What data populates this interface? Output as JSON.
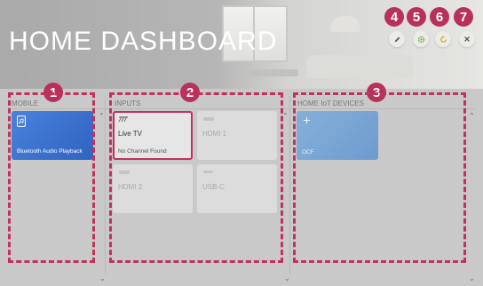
{
  "header": {
    "title": "HOME DASHBOARD",
    "buttons": [
      {
        "name": "edit",
        "icon": "pencil-icon"
      },
      {
        "name": "settings",
        "icon": "gear-icon"
      },
      {
        "name": "refresh",
        "icon": "refresh-icon"
      },
      {
        "name": "close",
        "icon": "close-icon"
      }
    ]
  },
  "callouts": [
    "1",
    "2",
    "3",
    "4",
    "5",
    "6",
    "7"
  ],
  "mobile": {
    "title": "MOBILE",
    "items": [
      {
        "label": "Bluetooth Audio Playback",
        "icon": "phone-music-icon"
      }
    ]
  },
  "inputs": {
    "title": "INPUTS",
    "items": [
      {
        "label": "Live TV",
        "status": "No Channel Found",
        "icon": "antenna-icon",
        "selected": true
      },
      {
        "label": "HDMI 1",
        "icon": "hdmi-port-icon"
      },
      {
        "label": "HDMI 2",
        "icon": "hdmi-port-icon"
      },
      {
        "label": "USB-C",
        "icon": "usb-port-icon"
      }
    ]
  },
  "iot": {
    "title": "HOME IoT DEVICES",
    "items": [
      {
        "label": "OCF",
        "icon": "plus-icon"
      }
    ]
  },
  "colors": {
    "accent": "#c0325a",
    "mobile_tile": "#3a6fd0",
    "iot_tile": "#7ea9d6",
    "background": "#c9c9c9"
  }
}
